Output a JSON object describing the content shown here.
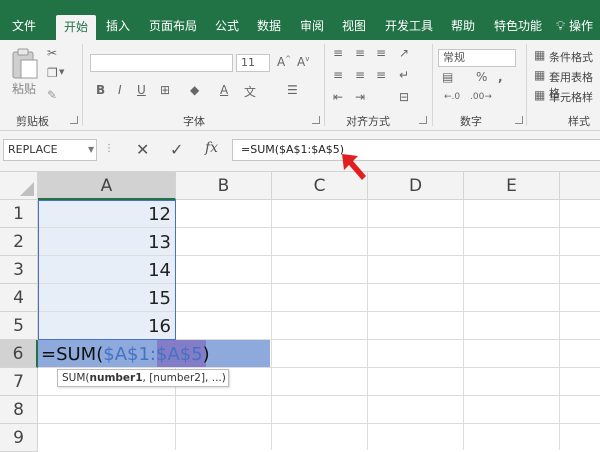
{
  "ribbon_tabs": [
    "文件",
    "开始",
    "插入",
    "页面布局",
    "公式",
    "数据",
    "审阅",
    "视图",
    "开发工具",
    "帮助",
    "特色功能"
  ],
  "active_tab": "开始",
  "tell_me": "操作",
  "clipboard": {
    "paste": "粘贴",
    "group": "剪贴板"
  },
  "font": {
    "size": "11",
    "group": "字体",
    "wen": "文"
  },
  "alignment": {
    "group": "对齐方式"
  },
  "number": {
    "format": "常规",
    "group": "数字",
    "percent": "%"
  },
  "styles": {
    "cond": "条件格式",
    "table": "套用表格格",
    "cell": "单元格样",
    "group": "样式"
  },
  "namebox": "REPLACE",
  "formula_bar": "=SUM($A$1:$A$5)",
  "columns": [
    "A",
    "B",
    "C",
    "D",
    "E"
  ],
  "rows": [
    "1",
    "2",
    "3",
    "4",
    "5",
    "6",
    "7",
    "8",
    "9"
  ],
  "values": [
    "12",
    "13",
    "14",
    "15",
    "16"
  ],
  "edit_cell": {
    "prefix": "=SUM(",
    "ref1": "$A$1",
    "colon": ":",
    "ref2": "$A$5",
    "suffix": ")"
  },
  "tooltip": {
    "func": "SUM(",
    "arg1": "number1",
    "rest": ", [number2], ...)"
  },
  "colors": {
    "excel_green": "#217346",
    "ref_blue": "#4472c4",
    "ref_purple": "#7030a0",
    "arrow_red": "#e02020"
  }
}
